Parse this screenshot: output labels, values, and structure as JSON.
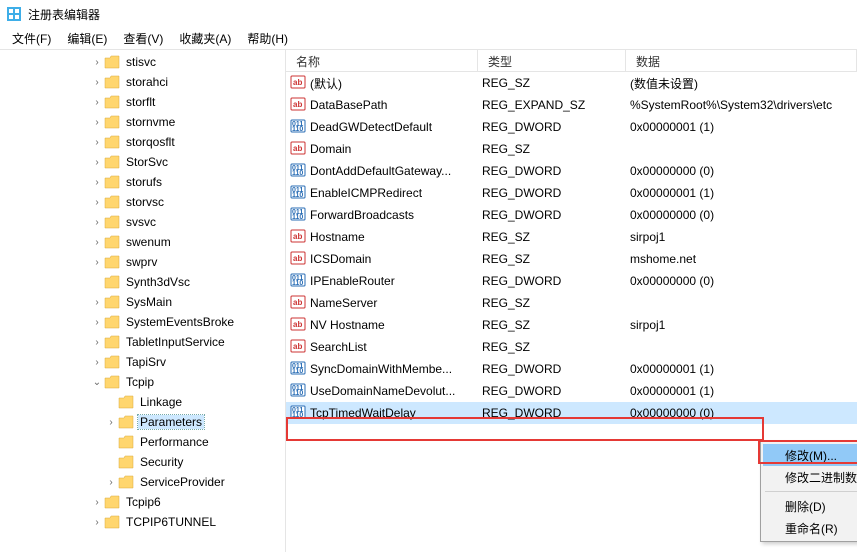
{
  "window": {
    "title": "注册表编辑器"
  },
  "menu": {
    "file": "文件(F)",
    "edit": "编辑(E)",
    "view": "查看(V)",
    "favorites": "收藏夹(A)",
    "help": "帮助(H)"
  },
  "tree": [
    {
      "indent": 0,
      "label": "stisvc",
      "twisty": ">"
    },
    {
      "indent": 0,
      "label": "storahci",
      "twisty": ">"
    },
    {
      "indent": 0,
      "label": "storflt",
      "twisty": ">"
    },
    {
      "indent": 0,
      "label": "stornvme",
      "twisty": ">"
    },
    {
      "indent": 0,
      "label": "storqosflt",
      "twisty": ">"
    },
    {
      "indent": 0,
      "label": "StorSvc",
      "twisty": ">"
    },
    {
      "indent": 0,
      "label": "storufs",
      "twisty": ">"
    },
    {
      "indent": 0,
      "label": "storvsc",
      "twisty": ">"
    },
    {
      "indent": 0,
      "label": "svsvc",
      "twisty": ">"
    },
    {
      "indent": 0,
      "label": "swenum",
      "twisty": ">"
    },
    {
      "indent": 0,
      "label": "swprv",
      "twisty": ">"
    },
    {
      "indent": 0,
      "label": "Synth3dVsc",
      "twisty": ""
    },
    {
      "indent": 0,
      "label": "SysMain",
      "twisty": ">"
    },
    {
      "indent": 0,
      "label": "SystemEventsBroke",
      "twisty": ">"
    },
    {
      "indent": 0,
      "label": "TabletInputService",
      "twisty": ">"
    },
    {
      "indent": 0,
      "label": "TapiSrv",
      "twisty": ">"
    },
    {
      "indent": 0,
      "label": "Tcpip",
      "twisty": "v",
      "expanded": true
    },
    {
      "indent": 1,
      "label": "Linkage",
      "twisty": ""
    },
    {
      "indent": 1,
      "label": "Parameters",
      "twisty": ">",
      "selected": true
    },
    {
      "indent": 1,
      "label": "Performance",
      "twisty": ""
    },
    {
      "indent": 1,
      "label": "Security",
      "twisty": ""
    },
    {
      "indent": 1,
      "label": "ServiceProvider",
      "twisty": ">"
    },
    {
      "indent": 0,
      "label": "Tcpip6",
      "twisty": ">"
    },
    {
      "indent": 0,
      "label": "TCPIP6TUNNEL",
      "twisty": ">"
    }
  ],
  "columns": {
    "name": "名称",
    "type": "类型",
    "data": "数据"
  },
  "values": [
    {
      "icon": "str",
      "name": "(默认)",
      "type": "REG_SZ",
      "data": "(数值未设置)"
    },
    {
      "icon": "str",
      "name": "DataBasePath",
      "type": "REG_EXPAND_SZ",
      "data": "%SystemRoot%\\System32\\drivers\\etc"
    },
    {
      "icon": "bin",
      "name": "DeadGWDetectDefault",
      "type": "REG_DWORD",
      "data": "0x00000001 (1)"
    },
    {
      "icon": "str",
      "name": "Domain",
      "type": "REG_SZ",
      "data": ""
    },
    {
      "icon": "bin",
      "name": "DontAddDefaultGateway...",
      "type": "REG_DWORD",
      "data": "0x00000000 (0)"
    },
    {
      "icon": "bin",
      "name": "EnableICMPRedirect",
      "type": "REG_DWORD",
      "data": "0x00000001 (1)"
    },
    {
      "icon": "bin",
      "name": "ForwardBroadcasts",
      "type": "REG_DWORD",
      "data": "0x00000000 (0)"
    },
    {
      "icon": "str",
      "name": "Hostname",
      "type": "REG_SZ",
      "data": "sirpoj1"
    },
    {
      "icon": "str",
      "name": "ICSDomain",
      "type": "REG_SZ",
      "data": "mshome.net"
    },
    {
      "icon": "bin",
      "name": "IPEnableRouter",
      "type": "REG_DWORD",
      "data": "0x00000000 (0)"
    },
    {
      "icon": "str",
      "name": "NameServer",
      "type": "REG_SZ",
      "data": ""
    },
    {
      "icon": "str",
      "name": "NV Hostname",
      "type": "REG_SZ",
      "data": "sirpoj1"
    },
    {
      "icon": "str",
      "name": "SearchList",
      "type": "REG_SZ",
      "data": ""
    },
    {
      "icon": "bin",
      "name": "SyncDomainWithMembe...",
      "type": "REG_DWORD",
      "data": "0x00000001 (1)"
    },
    {
      "icon": "bin",
      "name": "UseDomainNameDevolut...",
      "type": "REG_DWORD",
      "data": "0x00000001 (1)"
    },
    {
      "icon": "bin",
      "name": "TcpTimedWaitDelay",
      "type": "REG_DWORD",
      "data": "0x00000000 (0)",
      "selected": true
    }
  ],
  "context_menu": {
    "modify": "修改(M)...",
    "modify_binary": "修改二进制数据(B)...",
    "delete": "删除(D)",
    "rename": "重命名(R)"
  }
}
